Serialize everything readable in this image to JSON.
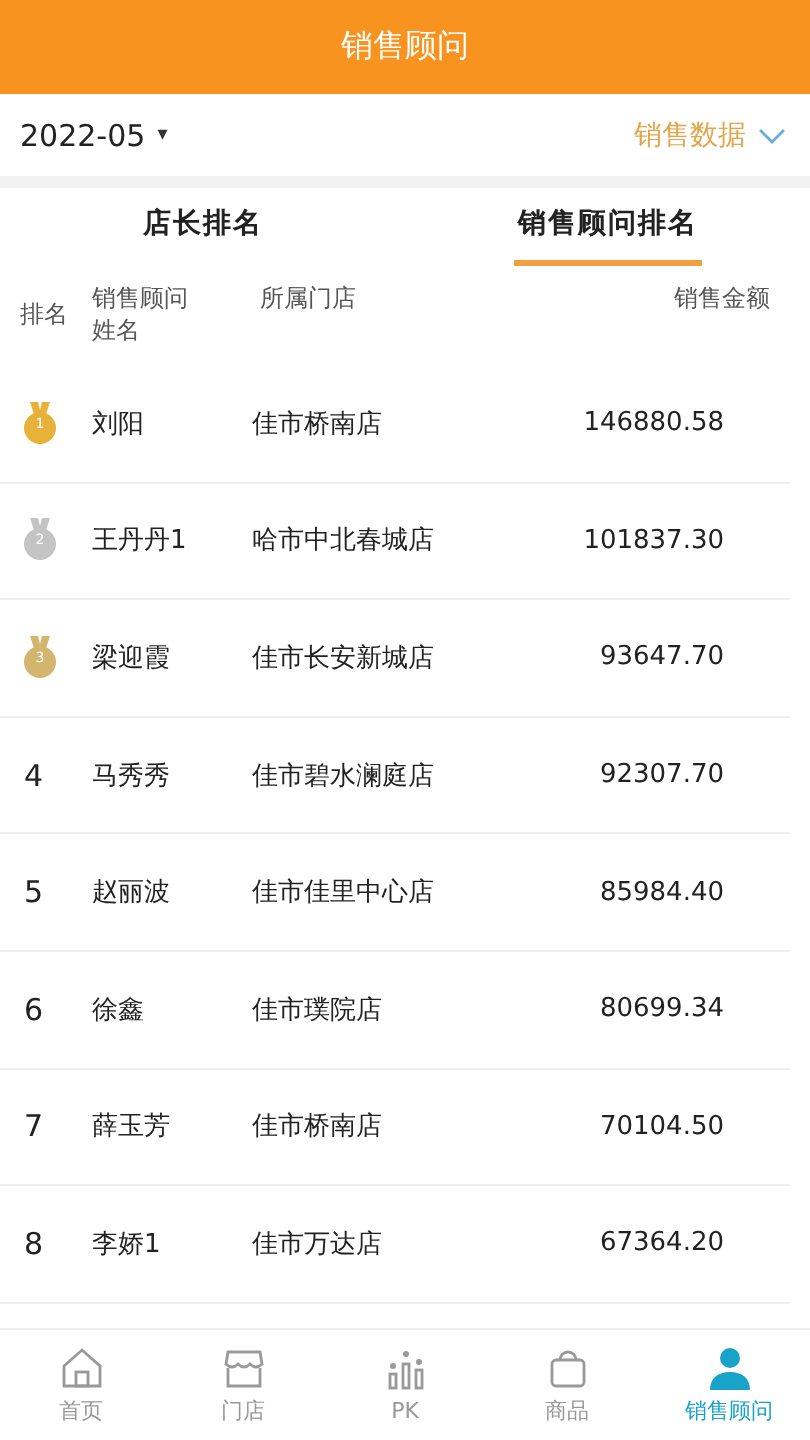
{
  "header": {
    "title": "销售顾问"
  },
  "filter": {
    "month": "2022-05",
    "caret": "▾",
    "data_type": "销售数据"
  },
  "tabs": [
    {
      "label": "店长排名",
      "selected": false
    },
    {
      "label": "销售顾问排名",
      "selected": true
    }
  ],
  "table": {
    "columns": [
      "排名",
      "销售顾问姓名",
      "所属门店",
      "销售金额"
    ],
    "rows": [
      {
        "kind": "medal",
        "rank": "1",
        "name": "刘阳",
        "store": "佳市桥南店",
        "amount": "146880.58",
        "color": "#e8b23a"
      },
      {
        "kind": "medal",
        "rank": "2",
        "name": "王丹丹1",
        "store": "哈市中北春城店",
        "amount": "101837.30",
        "color": "#c4c4c4"
      },
      {
        "kind": "medal",
        "rank": "3",
        "name": "梁迎霞",
        "store": "佳市长安新城店",
        "amount": "93647.70",
        "color": "#d4b56e"
      },
      {
        "kind": "number",
        "rank": "4",
        "name": "马秀秀",
        "store": "佳市碧水澜庭店",
        "amount": "92307.70"
      },
      {
        "kind": "number",
        "rank": "5",
        "name": "赵丽波",
        "store": "佳市佳里中心店",
        "amount": "85984.40"
      },
      {
        "kind": "number",
        "rank": "6",
        "name": "徐鑫",
        "store": "佳市璞院店",
        "amount": "80699.34"
      },
      {
        "kind": "number",
        "rank": "7",
        "name": "薛玉芳",
        "store": "佳市桥南店",
        "amount": "70104.50"
      },
      {
        "kind": "number",
        "rank": "8",
        "name": "李娇1",
        "store": "佳市万达店",
        "amount": "67364.20"
      }
    ]
  },
  "nav": [
    {
      "kind": "home",
      "label": "首页",
      "selected": false
    },
    {
      "kind": "store",
      "label": "门店",
      "selected": false
    },
    {
      "kind": "pk",
      "label": "PK",
      "selected": false
    },
    {
      "kind": "bag",
      "label": "商品",
      "selected": false
    },
    {
      "kind": "person",
      "label": "销售顾问",
      "selected": true
    }
  ]
}
